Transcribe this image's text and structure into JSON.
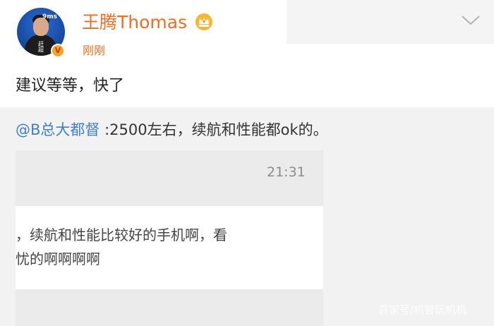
{
  "post": {
    "username": "王腾Thomas",
    "timestamp": "刚刚",
    "text": "建议等等，快了",
    "avatar_shirt_text": "赶超",
    "avatar_tag": "9ms"
  },
  "quote": {
    "mention": "@B总大都督",
    "text": ":2500左右，续航和性能都ok的。"
  },
  "screenshot": {
    "time": "21:31",
    "line1": "，续航和性能比较好的手机啊，看",
    "line2": "忧的啊啊啊啊"
  },
  "watermark": "百家号/机智玩机机",
  "colors": {
    "username": "#f26d1f",
    "mention": "#3f7fd0",
    "quote_bg": "#f2f2f2",
    "screenshot_bg": "#ebebeb"
  },
  "icons": {
    "badge": "verified-v-icon",
    "crown": "crown-icon",
    "menu": "chevron-down-icon"
  }
}
